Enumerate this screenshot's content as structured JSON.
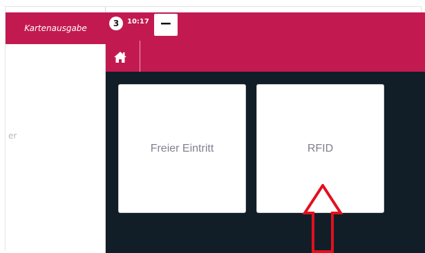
{
  "left_panel": {
    "header": "Kartenausgabe",
    "partial_text": "er"
  },
  "topbar": {
    "badge_count": "3",
    "time": "10:17",
    "minus_label": "−"
  },
  "tiles": [
    {
      "label": "Freier Eintritt"
    },
    {
      "label": "RFID"
    }
  ],
  "colors": {
    "accent": "#c21a50",
    "content_bg": "#111e28",
    "arrow": "#e3101e"
  }
}
